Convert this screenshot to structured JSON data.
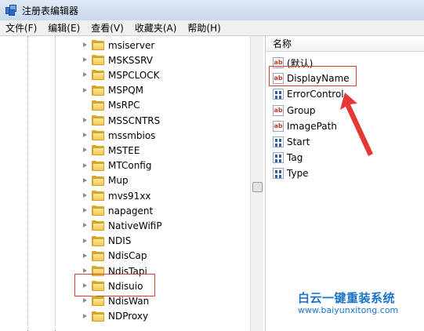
{
  "window": {
    "title": "注册表编辑器"
  },
  "menu": [
    "文件(F)",
    "编辑(E)",
    "查看(V)",
    "收藏夹(A)",
    "帮助(H)"
  ],
  "tree": {
    "items": [
      {
        "label": "msiserver",
        "expandable": true
      },
      {
        "label": "MSKSSRV",
        "expandable": true
      },
      {
        "label": "MSPCLOCK",
        "expandable": true
      },
      {
        "label": "MSPQM",
        "expandable": true
      },
      {
        "label": "MsRPC",
        "expandable": false
      },
      {
        "label": "MSSCNTRS",
        "expandable": true
      },
      {
        "label": "mssmbios",
        "expandable": true
      },
      {
        "label": "MSTEE",
        "expandable": true
      },
      {
        "label": "MTConfig",
        "expandable": true
      },
      {
        "label": "Mup",
        "expandable": true
      },
      {
        "label": "mvs91xx",
        "expandable": true
      },
      {
        "label": "napagent",
        "expandable": true
      },
      {
        "label": "NativeWifiP",
        "expandable": true
      },
      {
        "label": "NDIS",
        "expandable": true
      },
      {
        "label": "NdisCap",
        "expandable": true
      },
      {
        "label": "NdisTapi",
        "expandable": true
      },
      {
        "label": "Ndisuio",
        "expandable": true,
        "highlighted": true
      },
      {
        "label": "NdisWan",
        "expandable": true
      },
      {
        "label": "NDProxy",
        "expandable": true
      }
    ]
  },
  "values": {
    "column_name": "名称",
    "items": [
      {
        "label": "(默认)",
        "type": "string"
      },
      {
        "label": "DisplayName",
        "type": "string",
        "highlighted": true
      },
      {
        "label": "ErrorControl",
        "type": "binary"
      },
      {
        "label": "Group",
        "type": "string"
      },
      {
        "label": "ImagePath",
        "type": "string"
      },
      {
        "label": "Start",
        "type": "binary"
      },
      {
        "label": "Tag",
        "type": "binary"
      },
      {
        "label": "Type",
        "type": "binary"
      }
    ]
  },
  "icons": {
    "string_value": "ab-icon",
    "binary_value": "binary-value-icon",
    "folder": "folder-icon"
  },
  "colors": {
    "highlight": "#e53935",
    "watermark": "#1a73c9",
    "folder": "#f4c84a"
  },
  "watermark": {
    "title": "白云一键重装系统",
    "url": "www.baiyunxitong.com"
  }
}
